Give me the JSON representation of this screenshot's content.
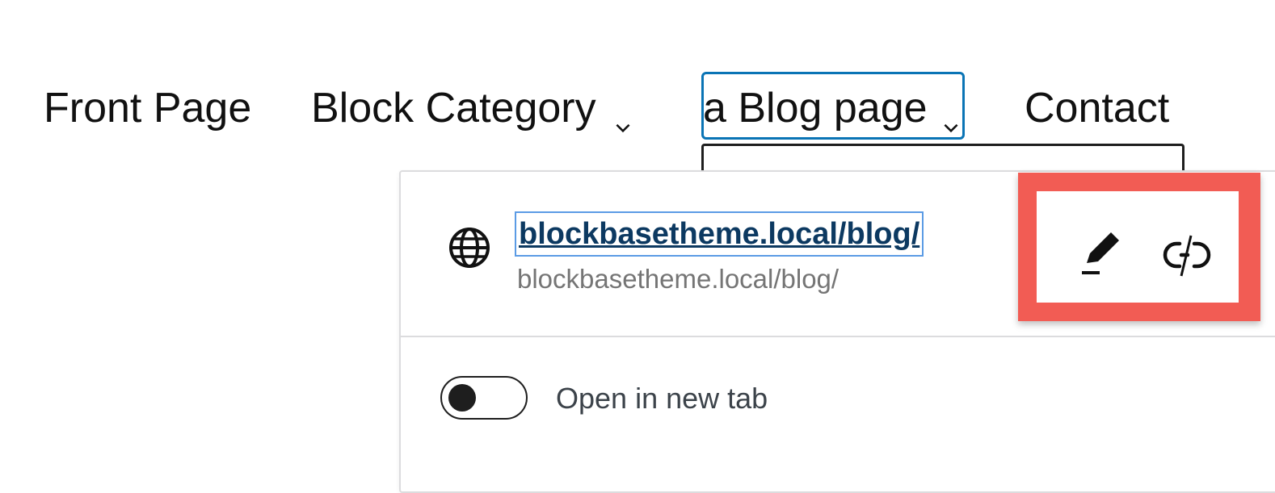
{
  "navigation": {
    "items": [
      {
        "label": "Front Page",
        "has_submenu": false
      },
      {
        "label": "Block Category",
        "has_submenu": true
      },
      {
        "label": "a Blog page",
        "has_submenu": true,
        "selected": true
      },
      {
        "label": "Contact",
        "has_submenu": false
      }
    ]
  },
  "link_popover": {
    "link_icon": "globe-icon",
    "link_title": "blockbasetheme.local/blog/",
    "link_url": "blockbasetheme.local/blog/",
    "actions": {
      "edit_icon": "pencil-icon",
      "unlink_icon": "link-off-icon"
    },
    "open_in_new_tab": {
      "label": "Open in new tab",
      "enabled": false
    }
  },
  "colors": {
    "selection_border": "#0a74b5",
    "link_text": "#0c3961",
    "link_focus": "#5b9be5",
    "highlight": "#f25c54",
    "muted_text": "#757575"
  }
}
